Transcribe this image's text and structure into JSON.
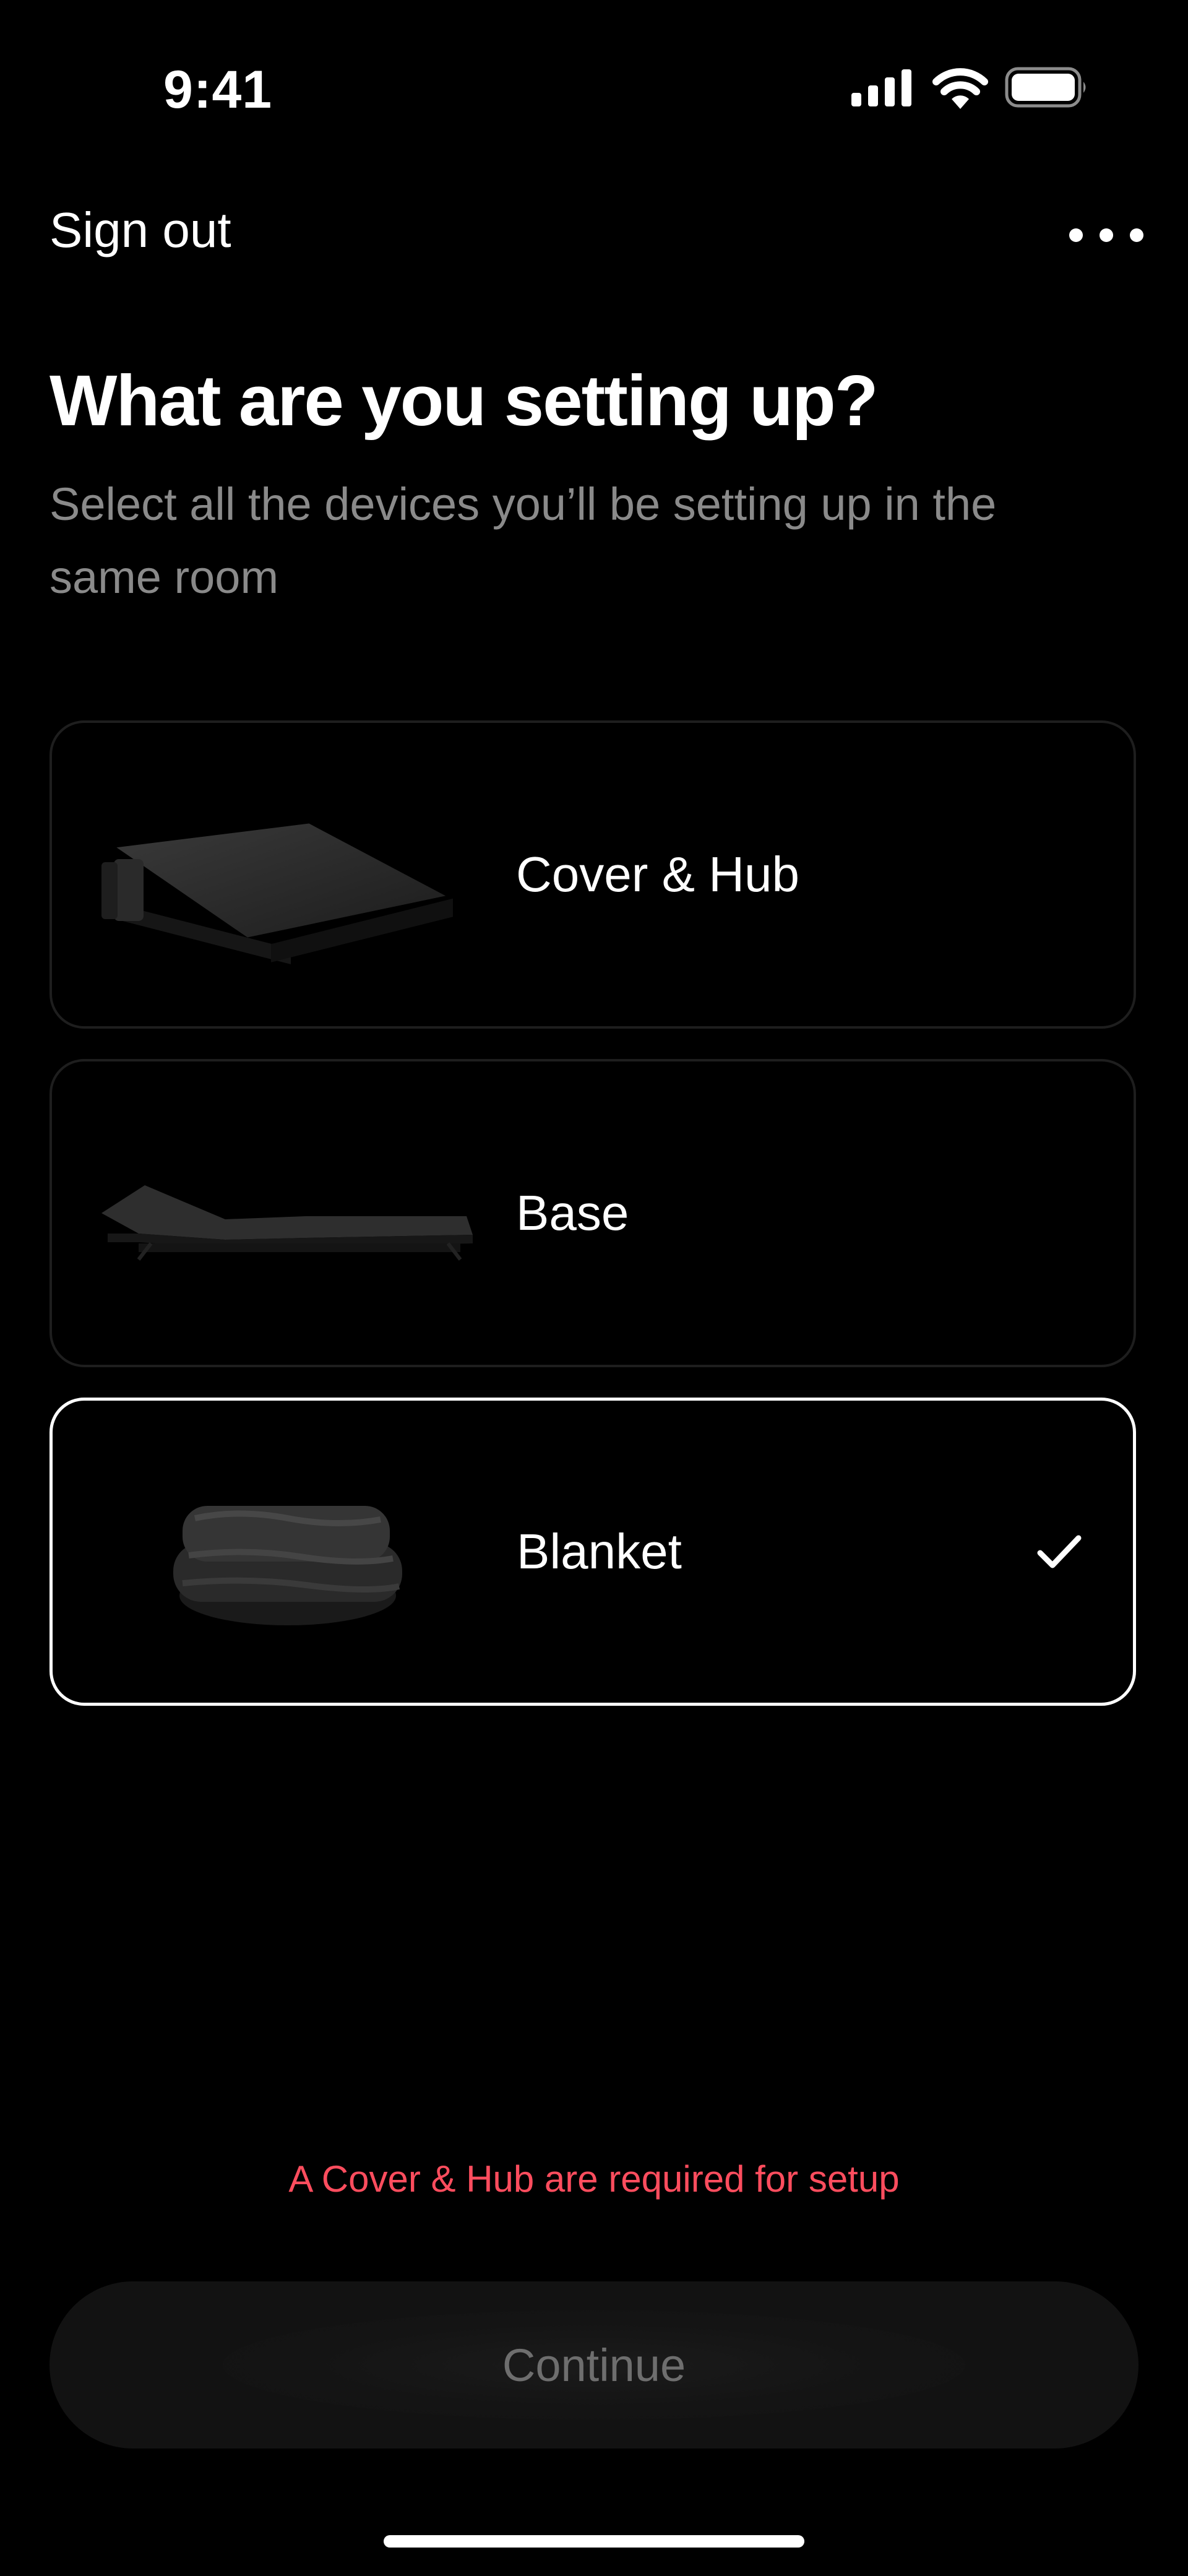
{
  "status_bar": {
    "time": "9:41",
    "icons": [
      "signal-icon",
      "wifi-icon",
      "battery-icon"
    ]
  },
  "nav": {
    "sign_out_label": "Sign out",
    "more_icon": "more-icon"
  },
  "header": {
    "title": "What are you setting up?",
    "subtitle": "Select all the devices you’ll be setting up in the same room"
  },
  "devices": [
    {
      "label": "Cover & Hub",
      "selected": false
    },
    {
      "label": "Base",
      "selected": false
    },
    {
      "label": "Blanket",
      "selected": true
    }
  ],
  "error_message": "A Cover & Hub are required for setup",
  "continue_label": "Continue",
  "colors": {
    "background": "#000000",
    "error": "#ff4d5e",
    "card_border": "#1e1e1e",
    "selected_border": "#ffffff"
  }
}
